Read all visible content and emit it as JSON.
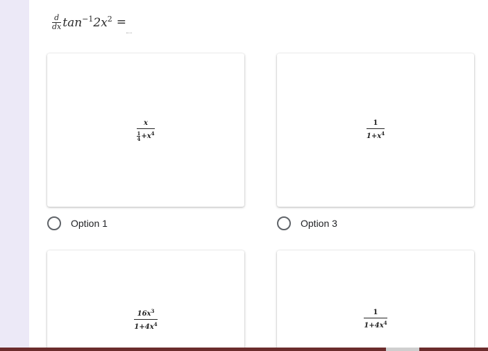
{
  "question": {
    "d_num": "d",
    "d_den": "dx",
    "func": "tan",
    "exp1": "−1",
    "arg": "2x",
    "exp2": "2",
    "equals": "="
  },
  "options": [
    {
      "label": "Option 1",
      "num": "x",
      "den_small_num": "1",
      "den_small_den": "4",
      "den_rest": "+x",
      "den_exp": "4"
    },
    {
      "label": "Option 3",
      "num": "1",
      "den": "1+x",
      "den_exp": "4"
    },
    {
      "num": "16x",
      "num_exp": "3",
      "den": "1+4x",
      "den_exp": "4"
    },
    {
      "num": "1",
      "den": "1+4x",
      "den_exp": "4"
    }
  ],
  "colors": {
    "page_bg": "#efebf8",
    "card_bg": "#ffffff",
    "radio_border": "#5f6368",
    "taskbar": "#6b2c2c"
  },
  "icons": [
    "radio-icon"
  ]
}
